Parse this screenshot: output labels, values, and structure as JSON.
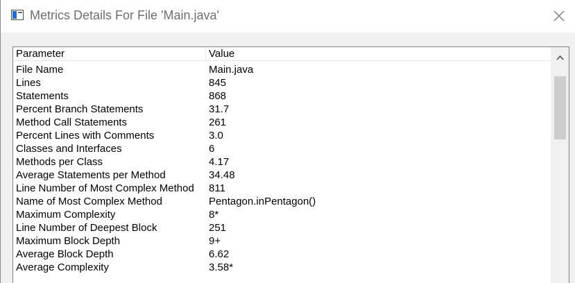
{
  "window": {
    "title": "Metrics Details For File 'Main.java'"
  },
  "table": {
    "headers": {
      "parameter": "Parameter",
      "value": "Value"
    },
    "rows": [
      {
        "parameter": "File Name",
        "value": "Main.java"
      },
      {
        "parameter": "Lines",
        "value": "845"
      },
      {
        "parameter": "Statements",
        "value": "868"
      },
      {
        "parameter": "Percent Branch Statements",
        "value": "31.7"
      },
      {
        "parameter": "Method Call Statements",
        "value": "261"
      },
      {
        "parameter": "Percent Lines with Comments",
        "value": "3.0"
      },
      {
        "parameter": "Classes and Interfaces",
        "value": "6"
      },
      {
        "parameter": "Methods per Class",
        "value": "4.17"
      },
      {
        "parameter": "Average Statements per Method",
        "value": "34.48"
      },
      {
        "parameter": "Line Number of Most Complex Method",
        "value": "811"
      },
      {
        "parameter": "Name of Most Complex Method",
        "value": "Pentagon.inPentagon()"
      },
      {
        "parameter": "Maximum Complexity",
        "value": "8*"
      },
      {
        "parameter": "Line Number of Deepest Block",
        "value": "251"
      },
      {
        "parameter": "Maximum Block Depth",
        "value": "9+"
      },
      {
        "parameter": "Average Block Depth",
        "value": "6.62"
      },
      {
        "parameter": "Average Complexity",
        "value": "3.58*"
      }
    ]
  },
  "icons": {
    "window_icon": "window-icon",
    "close": "close-icon",
    "scroll_up": "chevron-up-icon"
  }
}
